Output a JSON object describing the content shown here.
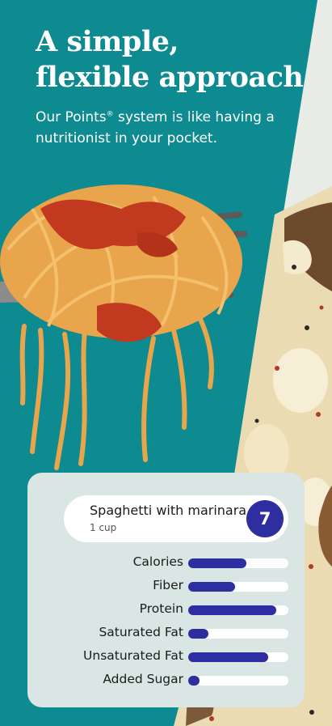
{
  "hero": {
    "title_line1": "A simple,",
    "title_line2": "flexible approach",
    "subtitle_before_mark": "Our Points",
    "registered_mark": "®",
    "subtitle_after_mark": " system is like having a nutritionist in your pocket."
  },
  "food_card": {
    "name": "Spaghetti with marinara",
    "portion": "1 cup",
    "points": "7"
  },
  "nutrients": [
    {
      "label": "Calories",
      "level": 0.58
    },
    {
      "label": "Fiber",
      "level": 0.47
    },
    {
      "label": "Protein",
      "level": 0.88
    },
    {
      "label": "Saturated Fat",
      "level": 0.2
    },
    {
      "label": "Unsaturated Fat",
      "level": 0.8
    },
    {
      "label": "Added Sugar",
      "level": 0.11
    }
  ],
  "colors": {
    "background": "#0e8a91",
    "card": "#d9e6e4",
    "accent": "#2f2ea0",
    "pasta": "#e9a54c",
    "sauce": "#c1391f"
  }
}
